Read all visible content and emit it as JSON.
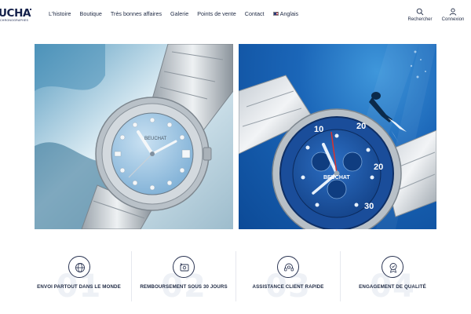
{
  "header": {
    "logo_text": "UCHAT",
    "logo_subtext": "CHRONOGRAPHES",
    "nav": [
      {
        "label": "L'histoire"
      },
      {
        "label": "Boutique"
      },
      {
        "label": "Très bonnes affaires"
      },
      {
        "label": "Galerie"
      },
      {
        "label": "Points de vente"
      },
      {
        "label": "Contact"
      },
      {
        "label": "Anglais",
        "icon": "uk-flag-icon"
      }
    ],
    "search_label": "Rechercher",
    "login_label": "Connexion"
  },
  "hero": {
    "left_watch_brand": "BEUCHAT",
    "right_watch_brand": "BEUCHAT"
  },
  "features": [
    {
      "number": "01",
      "label": "ENVOI PARTOUT DANS LE MONDE",
      "icon": "world-shipping-icon"
    },
    {
      "number": "02",
      "label": "REMBOURSEMENT SOUS 30 JOURS",
      "icon": "refund-icon"
    },
    {
      "number": "03",
      "label": "ASSISTANCE CLIENT RAPIDE",
      "icon": "support-icon"
    },
    {
      "number": "04",
      "label": "ENGAGEMENT DE QUALITÉ",
      "icon": "quality-badge-icon"
    }
  ],
  "colors": {
    "brand_navy": "#14204a",
    "text": "#1f2a44",
    "feature_number": "#eef1f6"
  }
}
